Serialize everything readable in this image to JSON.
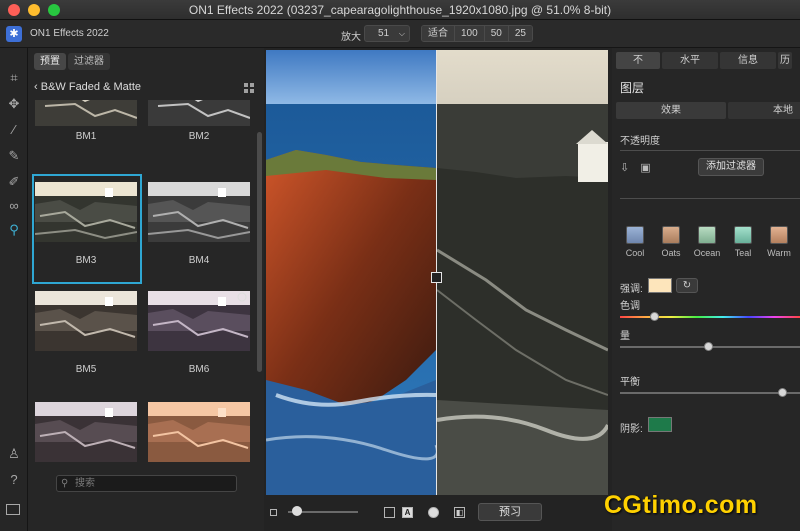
{
  "window": {
    "title": "ON1 Effects 2022 (03237_capearagolighthouse_1920x1080.jpg @ 51.0% 8-bit)"
  },
  "toolbar": {
    "app_name": "ON1 Effects 2022",
    "zoom_label": "放大",
    "zoom_value": "51",
    "fit_label": "适合",
    "zoom_presets": [
      "100",
      "50",
      "25"
    ]
  },
  "browser": {
    "tabs": [
      "预置",
      "过滤器"
    ],
    "selected_tab": "预置",
    "category": "B&W Faded & Matte",
    "presets": [
      {
        "name": "BM1"
      },
      {
        "name": "BM2"
      },
      {
        "name": "BM3",
        "selected": true
      },
      {
        "name": "BM4"
      },
      {
        "name": "BM5"
      },
      {
        "name": "BM6"
      },
      {
        "name": ""
      },
      {
        "name": ""
      }
    ],
    "search_placeholder": "搜索"
  },
  "canvas": {
    "preview_label": "预习"
  },
  "right_panel": {
    "tabs": [
      "不",
      "水平",
      "信息",
      "历"
    ],
    "layer_title": "图层",
    "sub_tabs": [
      "效果",
      "本地"
    ],
    "opacity_label": "不透明度",
    "add_filter_label": "添加过滤器",
    "tone_presets": [
      {
        "name": "Cool",
        "color": "#8ba4c8"
      },
      {
        "name": "Oats",
        "color": "#c99e7a"
      },
      {
        "name": "Ocean",
        "color": "#a3c9ae"
      },
      {
        "name": "Teal",
        "color": "#8ccbb8"
      },
      {
        "name": "Warm",
        "color": "#d4a080"
      }
    ],
    "tint_label": "强调:",
    "tint_color": "#fde5bb",
    "hue_label": "色调",
    "amount_label": "量",
    "balance_label": "平衡",
    "shadow_label": "阴影:",
    "shadow_color": "#1e7a4a"
  },
  "watermark": "CGtimo.com"
}
